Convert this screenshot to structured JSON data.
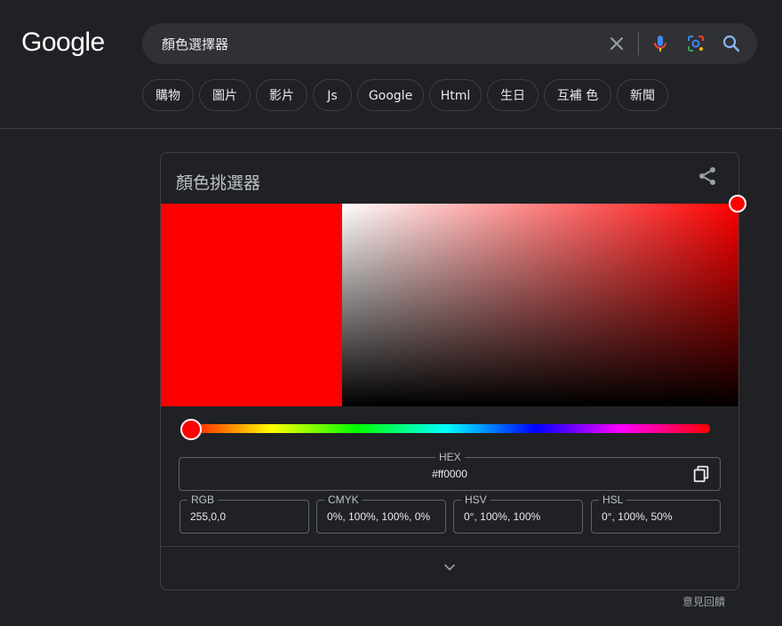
{
  "header": {
    "logo": "Google",
    "search": {
      "query": "顏色選擇器",
      "clear_label": "clear-icon",
      "voice_label": "microphone-icon",
      "lens_label": "lens-icon",
      "search_label": "search-icon"
    }
  },
  "chips": [
    "購物",
    "圖片",
    "影片",
    "Js",
    "Google",
    "Html",
    "生日",
    "互補 色",
    "新聞"
  ],
  "color_picker": {
    "title": "顏色挑選器",
    "selected_color": "#ff0000",
    "hue_level_percent": 0,
    "hex": {
      "label": "HEX",
      "value": "#ff0000"
    },
    "rgb": {
      "label": "RGB",
      "value": "255,0,0"
    },
    "cmyk": {
      "label": "CMYK",
      "value": "0%, 100%, 100%, 0%"
    },
    "hsv": {
      "label": "HSV",
      "value": "0°, 100%, 100%"
    },
    "hsl": {
      "label": "HSL",
      "value": "0°, 100%, 50%"
    }
  },
  "footer": {
    "feedback": "意見回饋"
  },
  "colors": {
    "background": "#202124",
    "search_bg": "#303134",
    "border": "#3c4043",
    "text": "#e8eaed",
    "muted": "#9aa0a6"
  }
}
